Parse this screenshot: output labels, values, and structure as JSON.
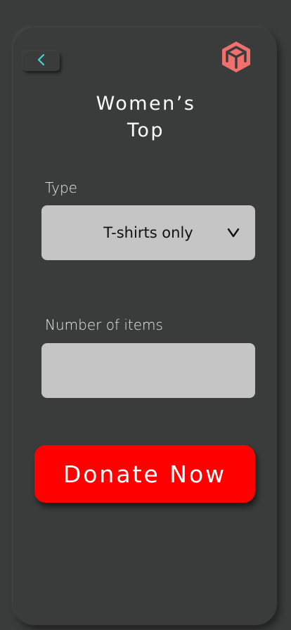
{
  "header": {
    "back_icon": "chevron-left-icon",
    "logo_icon": "cube-icon",
    "accent_color": "#f0706e",
    "title_line1": "Women’s",
    "title_line2": "Top"
  },
  "form": {
    "type_label": "Type",
    "type_value": "T-shirts only",
    "dropdown_icon": "chevron-down-icon",
    "items_label": "Number of items",
    "items_value": ""
  },
  "cta": {
    "donate_label": "Donate Now",
    "donate_color": "#ff0000"
  }
}
